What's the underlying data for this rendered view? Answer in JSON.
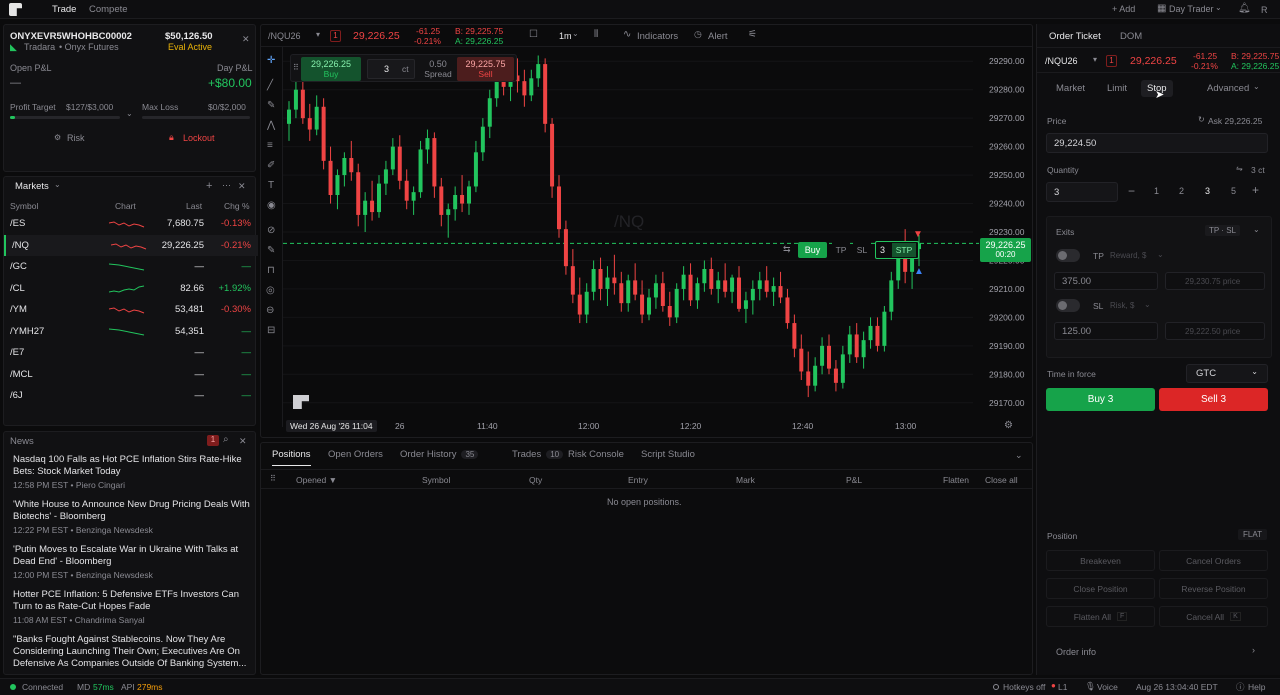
{
  "topbar": {
    "tabs": [
      "Trade",
      "Compete"
    ],
    "add": "+ Add",
    "layout": "Day Trader",
    "avatar": "R"
  },
  "account": {
    "id": "ONYXEVR5WHOHBC00002",
    "balance": "$50,126.50",
    "firm": "Tradara",
    "product": "• Onyx Futures",
    "status": "Eval Active",
    "open_pnl_label": "Open P&L",
    "open_pnl": "—",
    "day_pnl_label": "Day P&L",
    "day_pnl": "+$80.00",
    "profit_target_label": "Profit Target",
    "profit_target": "$127/$3,000",
    "profit_progress": 0.042,
    "max_loss_label": "Max Loss",
    "max_loss": "$0/$2,000",
    "max_loss_progress": 0,
    "risk": "Risk",
    "lockout": "Lockout"
  },
  "markets": {
    "title": "Markets",
    "cols": [
      "Symbol",
      "Chart",
      "Last",
      "Chg %"
    ],
    "rows": [
      {
        "sym": "/ES",
        "last": "7,680.75",
        "chg": "-0.13%",
        "dir": "down"
      },
      {
        "sym": "/NQ",
        "last": "29,226.25",
        "chg": "-0.21%",
        "dir": "down"
      },
      {
        "sym": "/GC",
        "last": "—",
        "chg": "—",
        "dir": "flat"
      },
      {
        "sym": "/CL",
        "last": "82.66",
        "chg": "+1.92%",
        "dir": "up"
      },
      {
        "sym": "/YM",
        "last": "53,481",
        "chg": "-0.30%",
        "dir": "down"
      },
      {
        "sym": "/YMH27",
        "last": "54,351",
        "chg": "—",
        "dir": "flat"
      },
      {
        "sym": "/E7",
        "last": "—",
        "chg": "—",
        "dir": "none"
      },
      {
        "sym": "/MCL",
        "last": "—",
        "chg": "—",
        "dir": "none"
      },
      {
        "sym": "/6J",
        "last": "—",
        "chg": "—",
        "dir": "none"
      }
    ]
  },
  "news": {
    "title": "News",
    "badge": "1",
    "items": [
      {
        "title": "Nasdaq 100 Falls as Hot PCE Inflation Stirs Rate-Hike Bets: Stock Market Today",
        "time": "12:58 PM EST",
        "source": "Piero Cingari"
      },
      {
        "title": "'White House to Announce New Drug Pricing Deals With Biotechs' - Bloomberg",
        "time": "12:22 PM EST",
        "source": "Benzinga Newsdesk"
      },
      {
        "title": "'Putin Moves to Escalate War in Ukraine With Talks at Dead End' - Bloomberg",
        "time": "12:00 PM EST",
        "source": "Benzinga Newsdesk"
      },
      {
        "title": "Hotter PCE Inflation: 5 Defensive ETFs Investors Can Turn to as Rate-Cut Hopes Fade",
        "time": "11:08 AM EST",
        "source": "Chandrima Sanyal"
      },
      {
        "title": "\"Banks Fought Against Stablecoins. Now They Are Considering Launching Their Own; Executives Are On Defensive As Companies Outside Of Banking System...",
        "time": "",
        "source": ""
      }
    ]
  },
  "chart": {
    "symbol": "/NQU26",
    "qty_badge": "1",
    "price": "29,226.25",
    "chg": "-61.25",
    "chg_pct": "-0.21%",
    "bid": "B: 29,225.75",
    "ask": "A: 29,226.25",
    "interval": "1m",
    "indicators": "Indicators",
    "alert": "Alert",
    "watermark": "/NQ",
    "buy_price": "29,226.25",
    "buy_label": "Buy",
    "qty": "3",
    "ct": "ct",
    "spread": "0.50",
    "spread_label": "Spread",
    "sell_price": "29,225.75",
    "sell_label": "Sell",
    "order_line": {
      "buy": "Buy",
      "tp": "TP",
      "sl": "SL",
      "qty": "3",
      "type": "STP"
    },
    "price_tag": "29,226.25",
    "price_tag_sub": "00:20",
    "y_ticks": [
      "29290.00",
      "29280.00",
      "29270.00",
      "29260.00",
      "29250.00",
      "29240.00",
      "29230.00",
      "29220.00",
      "29210.00",
      "29200.00",
      "29190.00",
      "29180.00",
      "29170.00"
    ],
    "x_ticks": [
      "26",
      "11:40",
      "12:00",
      "12:20",
      "12:40",
      "13:00"
    ],
    "cursor_date": "Wed 26 Aug '26 11:04"
  },
  "chart_data": {
    "type": "candlestick",
    "ylim": [
      29165,
      29295
    ],
    "candles": [
      [
        29268,
        29276,
        29262,
        29273
      ],
      [
        29273,
        29284,
        29270,
        29280
      ],
      [
        29280,
        29283,
        29268,
        29270
      ],
      [
        29270,
        29275,
        29262,
        29266
      ],
      [
        29266,
        29278,
        29264,
        29274
      ],
      [
        29274,
        29277,
        29252,
        29255
      ],
      [
        29255,
        29260,
        29240,
        29243
      ],
      [
        29243,
        29252,
        29238,
        29250
      ],
      [
        29250,
        29258,
        29246,
        29256
      ],
      [
        29256,
        29262,
        29248,
        29251
      ],
      [
        29251,
        29254,
        29232,
        29236
      ],
      [
        29236,
        29244,
        29230,
        29241
      ],
      [
        29241,
        29248,
        29234,
        29237
      ],
      [
        29237,
        29250,
        29235,
        29247
      ],
      [
        29247,
        29255,
        29243,
        29252
      ],
      [
        29252,
        29263,
        29250,
        29260
      ],
      [
        29260,
        29264,
        29245,
        29248
      ],
      [
        29248,
        29252,
        29238,
        29241
      ],
      [
        29241,
        29246,
        29236,
        29244
      ],
      [
        29244,
        29262,
        29242,
        29259
      ],
      [
        29259,
        29266,
        29254,
        29263
      ],
      [
        29263,
        29265,
        29242,
        29246
      ],
      [
        29246,
        29249,
        29232,
        29236
      ],
      [
        29236,
        29240,
        29228,
        29238
      ],
      [
        29238,
        29246,
        29234,
        29243
      ],
      [
        29243,
        29250,
        29237,
        29240
      ],
      [
        29240,
        29248,
        29236,
        29246
      ],
      [
        29246,
        29262,
        29244,
        29258
      ],
      [
        29258,
        29270,
        29255,
        29267
      ],
      [
        29267,
        29280,
        29263,
        29277
      ],
      [
        29277,
        29290,
        29274,
        29286
      ],
      [
        29286,
        29290,
        29278,
        29281
      ],
      [
        29281,
        29288,
        29276,
        29285
      ],
      [
        29285,
        29291,
        29279,
        29283
      ],
      [
        29283,
        29287,
        29274,
        29278
      ],
      [
        29278,
        29287,
        29276,
        29284
      ],
      [
        29284,
        29292,
        29281,
        29289
      ],
      [
        29289,
        29291,
        29265,
        29268
      ],
      [
        29268,
        29270,
        29242,
        29246
      ],
      [
        29246,
        29250,
        29228,
        29231
      ],
      [
        29231,
        29234,
        29215,
        29218
      ],
      [
        29218,
        29224,
        29205,
        29208
      ],
      [
        29208,
        29214,
        29198,
        29201
      ],
      [
        29201,
        29212,
        29198,
        29209
      ],
      [
        29209,
        29220,
        29206,
        29217
      ],
      [
        29217,
        29221,
        29206,
        29210
      ],
      [
        29210,
        29218,
        29204,
        29214
      ],
      [
        29214,
        29222,
        29208,
        29212
      ],
      [
        29212,
        29216,
        29202,
        29205
      ],
      [
        29205,
        29215,
        29202,
        29213
      ],
      [
        29213,
        29219,
        29206,
        29208
      ],
      [
        29208,
        29213,
        29198,
        29201
      ],
      [
        29201,
        29210,
        29199,
        29207
      ],
      [
        29207,
        29215,
        29203,
        29212
      ],
      [
        29212,
        29216,
        29202,
        29204
      ],
      [
        29204,
        29209,
        29197,
        29200
      ],
      [
        29200,
        29212,
        29198,
        29210
      ],
      [
        29210,
        29218,
        29206,
        29215
      ],
      [
        29215,
        29219,
        29204,
        29206
      ],
      [
        29206,
        29214,
        29203,
        29212
      ],
      [
        29212,
        29220,
        29209,
        29217
      ],
      [
        29217,
        29221,
        29208,
        29210
      ],
      [
        29210,
        29216,
        29205,
        29213
      ],
      [
        29213,
        29219,
        29207,
        29209
      ],
      [
        29209,
        29215,
        29205,
        29214
      ],
      [
        29214,
        29218,
        29202,
        29203
      ],
      [
        29203,
        29209,
        29198,
        29206
      ],
      [
        29206,
        29213,
        29201,
        29210
      ],
      [
        29210,
        29216,
        29206,
        29213
      ],
      [
        29213,
        29218,
        29207,
        29209
      ],
      [
        29209,
        29214,
        29204,
        29211
      ],
      [
        29211,
        29216,
        29205,
        29207
      ],
      [
        29207,
        29210,
        29196,
        29198
      ],
      [
        29198,
        29201,
        29186,
        29189
      ],
      [
        29189,
        29194,
        29178,
        29181
      ],
      [
        29181,
        29188,
        29172,
        29176
      ],
      [
        29176,
        29186,
        29174,
        29183
      ],
      [
        29183,
        29193,
        29180,
        29190
      ],
      [
        29190,
        29194,
        29180,
        29182
      ],
      [
        29182,
        29185,
        29174,
        29177
      ],
      [
        29177,
        29190,
        29175,
        29187
      ],
      [
        29187,
        29197,
        29184,
        29194
      ],
      [
        29194,
        29198,
        29184,
        29186
      ],
      [
        29186,
        29195,
        29182,
        29192
      ],
      [
        29192,
        29200,
        29189,
        29197
      ],
      [
        29197,
        29200,
        29188,
        29190
      ],
      [
        29190,
        29204,
        29188,
        29202
      ],
      [
        29202,
        29216,
        29199,
        29213
      ],
      [
        29213,
        29226,
        29210,
        29223
      ],
      [
        29223,
        29231,
        29212,
        29216
      ],
      [
        29216,
        29226,
        29210,
        29224
      ],
      [
        29224,
        29229,
        29218,
        29226
      ]
    ]
  },
  "bottom": {
    "tabs": [
      {
        "label": "Positions"
      },
      {
        "label": "Open Orders"
      },
      {
        "label": "Order History",
        "count": "35"
      },
      {
        "label": "Trades",
        "count": "10"
      },
      {
        "label": "Risk Console"
      },
      {
        "label": "Script Studio"
      }
    ],
    "cols": [
      "Opened ▼",
      "Symbol",
      "Qty",
      "Entry",
      "Mark",
      "P&L"
    ],
    "flatten": "Flatten",
    "close_all": "Close all",
    "empty": "No open positions."
  },
  "ticket": {
    "tabs": [
      "Order Ticket",
      "DOM"
    ],
    "symbol": "/NQU26",
    "qty_badge": "1",
    "price": "29,226.25",
    "chg": "-61.25",
    "chg_pct": "-0.21%",
    "bid": "B: 29,225.75",
    "ask": "A: 29,226.25",
    "types": [
      "Market",
      "Limit",
      "Stop"
    ],
    "advanced": "Advanced",
    "price_label": "Price",
    "ask_ref": "Ask 29,226.25",
    "price_value": "29,224.50",
    "qty_label": "Quantity",
    "qty_ct": "3 ct",
    "qty_value": "3",
    "presets": [
      "1",
      "2",
      "3",
      "5"
    ],
    "exits_label": "Exits",
    "exits_mode": "TP · SL",
    "tp_label": "TP",
    "tp_mode": "Reward, $",
    "tp_value": "375.00",
    "tp_price": "29,230.75 price",
    "sl_label": "SL",
    "sl_mode": "Risk, $",
    "sl_value": "125.00",
    "sl_price": "29,222.50 price",
    "tif_label": "Time in force",
    "tif_value": "GTC",
    "buy": "Buy 3",
    "sell": "Sell 3",
    "position_label": "Position",
    "position_state": "FLAT",
    "actions": [
      "Breakeven",
      "Cancel Orders",
      "Close Position",
      "Reverse Position",
      "Flatten All",
      "Cancel All"
    ],
    "keys": [
      "F",
      "K"
    ],
    "order_info": "Order info"
  },
  "status": {
    "connected": "Connected",
    "md": "MD",
    "md_ms": "57ms",
    "api": "API",
    "api_ms": "279ms",
    "hotkeys": "Hotkeys off",
    "level": "L1",
    "voice": "Voice",
    "time": "Aug 26 13:04:40 EDT",
    "help": "Help"
  },
  "colors": {
    "up": "#22c55e",
    "down": "#ef4444",
    "accent": "#16a34a"
  }
}
